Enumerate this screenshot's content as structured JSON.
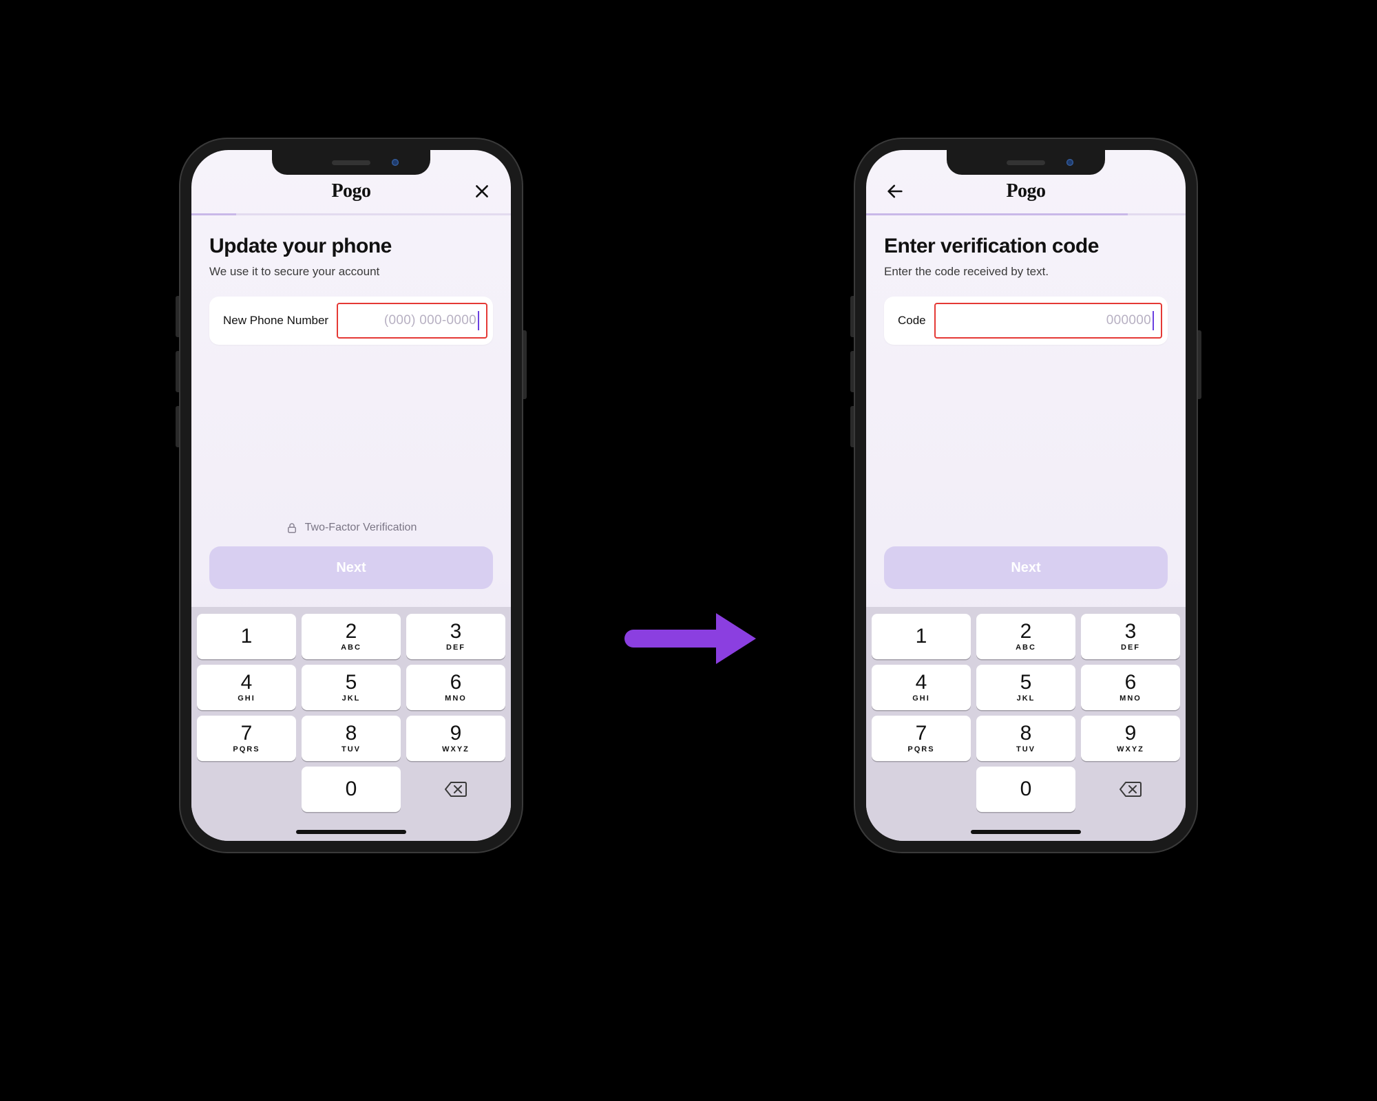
{
  "brand": "Pogo",
  "arrow_color": "#8b3fe0",
  "keypad": [
    {
      "digit": "1",
      "letters": ""
    },
    {
      "digit": "2",
      "letters": "ABC"
    },
    {
      "digit": "3",
      "letters": "DEF"
    },
    {
      "digit": "4",
      "letters": "GHI"
    },
    {
      "digit": "5",
      "letters": "JKL"
    },
    {
      "digit": "6",
      "letters": "MNO"
    },
    {
      "digit": "7",
      "letters": "PQRS"
    },
    {
      "digit": "8",
      "letters": "TUV"
    },
    {
      "digit": "9",
      "letters": "WXYZ"
    },
    {
      "digit": "0",
      "letters": ""
    }
  ],
  "screen1": {
    "title": "Update your phone",
    "subtitle": "We use it to secure your account",
    "field_label": "New Phone Number",
    "placeholder": "(000) 000-0000",
    "tfa_label": "Two-Factor Verification",
    "next_label": "Next",
    "progress_pct": "14%"
  },
  "screen2": {
    "title": "Enter verification code",
    "subtitle": "Enter the code received by text.",
    "field_label": "Code",
    "placeholder": "000000",
    "next_label": "Next",
    "progress_pct": "82%"
  }
}
